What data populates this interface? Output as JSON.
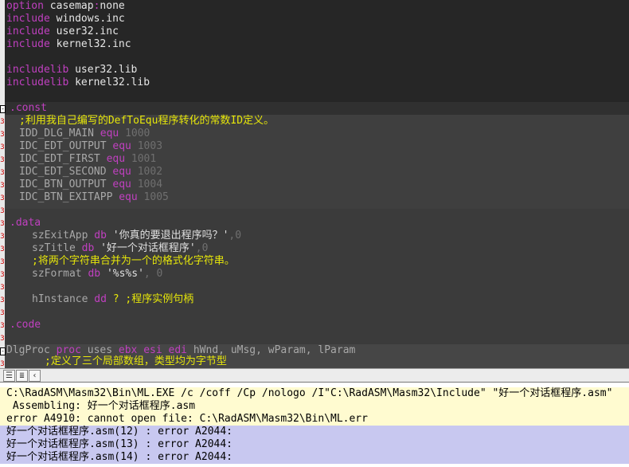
{
  "editor": {
    "header_lines": [
      {
        "kw": "option",
        "rest": " casemap",
        "punct": ":",
        "tail": "none"
      },
      {
        "kw": "include",
        "rest": " windows.inc"
      },
      {
        "kw": "include",
        "rest": " user32.inc"
      },
      {
        "kw": "include",
        "rest": " kernel32.inc"
      },
      {
        "kw": "includelib",
        "rest": " user32.lib"
      },
      {
        "kw": "includelib",
        "rest": " kernel32.lib"
      }
    ],
    "const_label": ".const",
    "const_comment": ";利用我自己编写的DefToEqu程序转化的常数ID定义。",
    "equ_kw": "equ",
    "consts": [
      {
        "name": "IDD_DLG_MAIN",
        "value": "1000"
      },
      {
        "name": "IDC_EDT_OUTPUT",
        "value": "1003"
      },
      {
        "name": "IDC_EDT_FIRST",
        "value": "1001"
      },
      {
        "name": "IDC_EDT_SECOND",
        "value": "1002"
      },
      {
        "name": "IDC_BTN_OUTPUT",
        "value": "1004"
      },
      {
        "name": "IDC_BTN_EXITAPP",
        "value": "1005"
      }
    ],
    "data_label": ".data",
    "data_lines": {
      "exit_name": "szExitApp",
      "db_kw": "db",
      "exit_str": "'你真的要退出程序吗？'",
      "exit_tail": ",0",
      "title_name": "szTitle",
      "title_str": "'好一个对话框程序'",
      "title_tail": ",0",
      "merge_comment": ";将两个字符串合并为一个的格式化字符串。",
      "format_name": "szFormat",
      "format_str": "'%s%s'",
      "format_tail": ", 0",
      "hinst_name": "hInstance",
      "dd_kw": "dd",
      "hinst_q": "?",
      "hinst_comment": ";程序实例句柄"
    },
    "code_label": ".code",
    "proc_line": {
      "name": "DlgProc",
      "proc_kw": "proc",
      "uses_kw": "uses",
      "regs": [
        "ebx",
        "esi",
        "edi"
      ],
      "params": [
        "hWnd",
        "uMsg",
        "wParam",
        "lParam"
      ]
    },
    "local_comment": ";定义了三个局部数组，类型均为字节型"
  },
  "toolbar": {
    "icons": [
      "view-code-icon",
      "view-list-icon",
      "scroll-left-icon"
    ]
  },
  "output": {
    "lines": [
      "C:\\RadASM\\Masm32\\Bin\\ML.EXE /c /coff /Cp /nologo /I\"C:\\RadASM\\Masm32\\Include\" \"好一个对话框程序.asm\"",
      " Assembling: 好一个对话框程序.asm",
      "error A4910: cannot open file: C:\\RadASM\\Masm32\\Bin\\ML.err",
      "好一个对话框程序.asm(12) : error A2044:",
      "好一个对话框程序.asm(13) : error A2044:",
      "好一个对话框程序.asm(14) : error A2044:"
    ]
  },
  "colors": {
    "keyword": "#c040c0",
    "comment": "#e6e60a",
    "number": "#6f6f6f",
    "editor_bg_dark": "#262626",
    "editor_bg_block": "#3f3f3f",
    "output_highlight": "#c8c8f0",
    "output_yellow": "#fffbd0"
  }
}
